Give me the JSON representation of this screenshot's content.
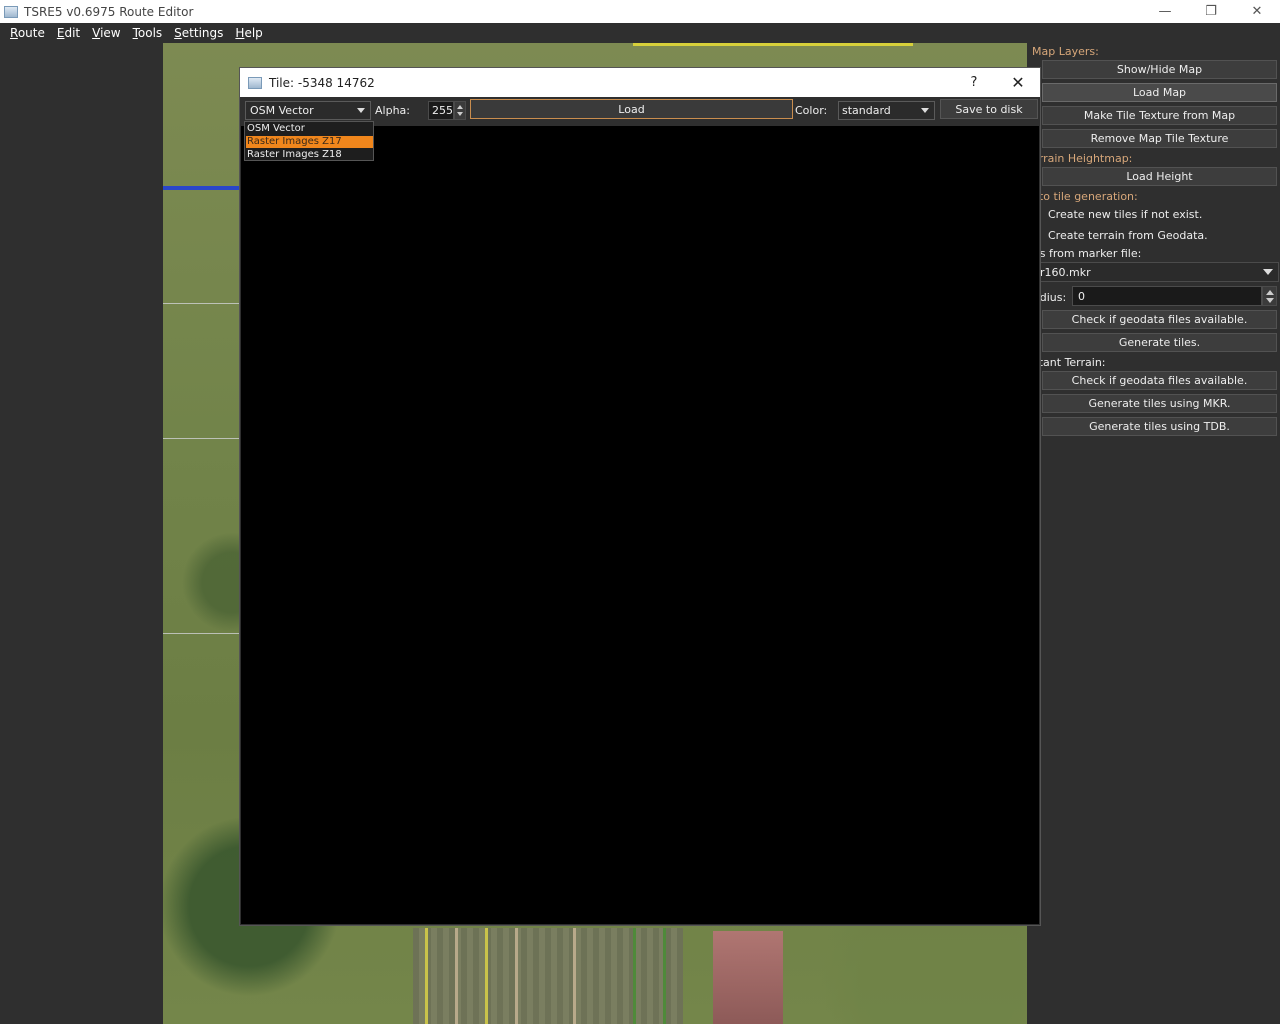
{
  "window": {
    "title": "TSRE5 v0.6975 Route Editor",
    "controls": {
      "minimize": "—",
      "restore": "❐",
      "close": "✕"
    }
  },
  "menubar": {
    "items": [
      {
        "label_first": "R",
        "label_rest": "oute"
      },
      {
        "label_first": "E",
        "label_rest": "dit"
      },
      {
        "label_first": "V",
        "label_rest": "iew"
      },
      {
        "label_first": "T",
        "label_rest": "ools"
      },
      {
        "label_first": "S",
        "label_rest": "ettings"
      },
      {
        "label_first": "H",
        "label_rest": "elp"
      }
    ]
  },
  "tile_dialog": {
    "title": "Tile: -5348 14762",
    "help": "?",
    "close": "✕",
    "source_combo": "OSM Vector",
    "source_options": [
      "OSM Vector",
      "Raster Images Z17",
      "Raster Images Z18"
    ],
    "source_highlighted_index": 1,
    "alpha_label": "Alpha:",
    "alpha_value": "255",
    "load_label": "Load",
    "color_label": "Color:",
    "color_value": "standard",
    "save_label": "Save to disk"
  },
  "right_panel": {
    "map_layers_label": "Map Layers:",
    "show_hide_map": "Show/Hide Map",
    "load_map": "Load Map",
    "make_tile_texture": "Make Tile Texture from Map",
    "remove_map_tile_texture": "Remove Map Tile Texture",
    "terrain_heightmap_label": "errain Heightmap:",
    "load_height": "Load Height",
    "auto_tile_label": "uto tile generation:",
    "create_new_tiles": "Create new tiles if not exist.",
    "create_terrain_geodata": "Create terrain from Geodata.",
    "tiles_marker_label": "es from marker file:",
    "marker_file": "r160.mkr",
    "radius_label": "adius:",
    "radius_value": "0",
    "check_geodata_1": "Check if geodata files available.",
    "generate_tiles": "Generate tiles.",
    "distant_terrain_label": "stant Terrain:",
    "check_geodata_2": "Check if geodata files available.",
    "generate_mkr": "Generate tiles using MKR.",
    "generate_tdb": "Generate tiles using TDB."
  },
  "colors": {
    "accent_orange": "#f0861c",
    "section_label": "#d7a77a",
    "panel_bg": "#2f2f2f"
  }
}
